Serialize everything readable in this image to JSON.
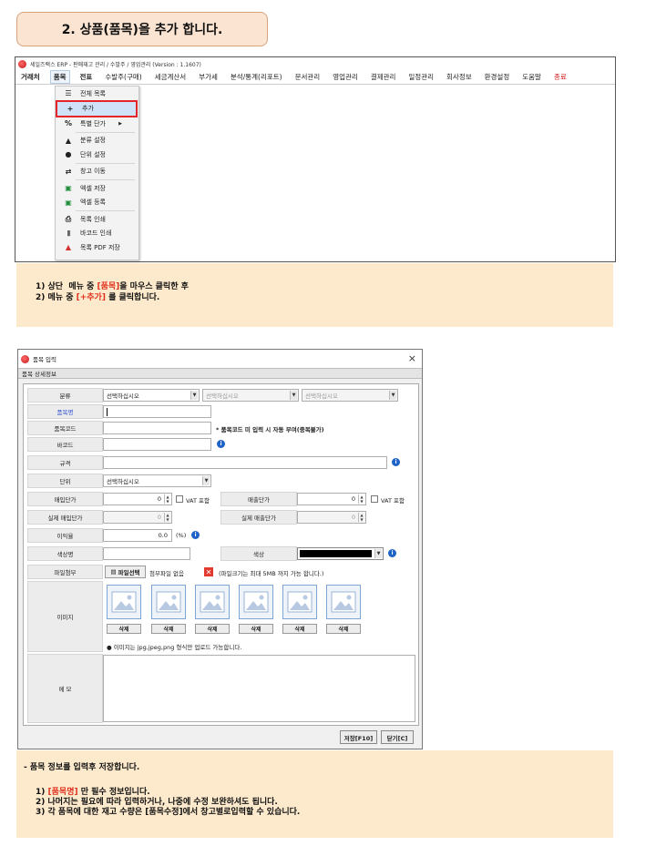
{
  "step_title": "2. 상품(품목)을 추가 합니다.",
  "app_window": {
    "title": "세일즈랙스 ERP - 판매재고 관리 / 수발주 / 영업관리 (Version : 1.1607)",
    "menu": [
      "거래처",
      "품목",
      "전표",
      "수발주(구매)",
      "세금계산서",
      "부가세",
      "분석/통계(리포트)",
      "문서관리",
      "영업관리",
      "결제관리",
      "일정관리",
      "회사정보",
      "환경설정",
      "도움말",
      "종료"
    ],
    "dropdown": [
      {
        "icon": "☰",
        "label": "전체 목록"
      },
      {
        "icon": "+",
        "label": "추가"
      },
      {
        "icon": "%",
        "label": "특별 단가"
      },
      {
        "icon": "▲",
        "label": "분류 설정"
      },
      {
        "icon": "●",
        "label": "단위 설정"
      },
      {
        "icon": "⇄",
        "label": "창고 이동"
      },
      {
        "icon": "▣",
        "label": "엑셀 저장"
      },
      {
        "icon": "▣",
        "label": "엑셀 등록"
      },
      {
        "icon": "⎙",
        "label": "목록 인쇄"
      },
      {
        "icon": "|||",
        "label": "바코드 인쇄"
      },
      {
        "icon": "▲",
        "label": "목록 PDF 저장"
      }
    ]
  },
  "info1": {
    "line1_pre": "1) 상단  메뉴 중 ",
    "line1_hl": "[품목]",
    "line1_post": "을 마우스 클릭한 후",
    "line2_pre": "2) 메뉴 중 ",
    "line2_hl": "[+추가]",
    "line2_post": " 를 클릭합니다."
  },
  "dialog": {
    "title": "품목 입력",
    "close": "×",
    "section": "품목 상세정보",
    "labels": {
      "category": "분류",
      "name": "품목명",
      "code": "품목코드",
      "barcode": "바코드",
      "spec": "규격",
      "unit": "단위",
      "buy_price": "매입단가",
      "sell_price": "매출단가",
      "real_buy": "실제 매입단가",
      "real_sell": "실제 매출단가",
      "margin": "이익율",
      "color_name": "색상명",
      "color": "색상",
      "attach": "파일첨부",
      "image": "이미지",
      "memo": "메 모"
    },
    "select_placeholder": "선택하십시오",
    "code_note": "* 품목코드 미 입력 시 자동 부여(중복불가)",
    "vat": "VAT 포함",
    "zero": "0",
    "margin_val": "0.0",
    "percent": "(%)",
    "file_button": "파일선택",
    "no_file": "첨부파일 없음",
    "file_note": "(파일크기는 최대 5MB 까지 가능 합니다.)",
    "delete": "삭제",
    "image_note": "● 이미지는 jpg,jpeg,png 형식만 업로드 가능합니다.",
    "save": "저장[F10]",
    "close_btn": "닫기[C]"
  },
  "info2": {
    "intro": "- 품목 정보를 입력후 저장합니다.",
    "l1_pre": "1) ",
    "l1_hl": "[품목명]",
    "l1_post": " 만 필수 정보입니다.",
    "l2": "2) 나머지는 필요에 따라 입력하거나, 나중에 수정 보완하셔도 됩니다.",
    "l3": "3) 각 품목에 대한 재고 수량은 [품목수정]에서 창고별로입력할 수 있습니다."
  },
  "colors": {
    "highlight": "#e0311f",
    "info_bg": "#fde9cc",
    "required_label": "#2c4fd1"
  }
}
